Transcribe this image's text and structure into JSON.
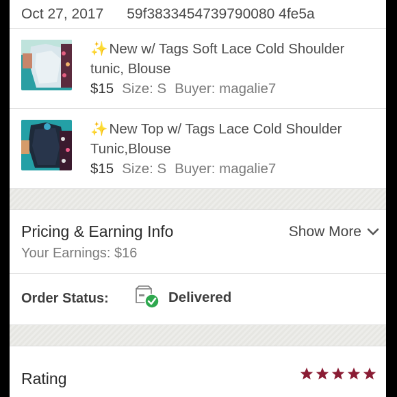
{
  "order": {
    "date": "Oct 27, 2017",
    "id": "59f3833454739790080 4fe5a"
  },
  "items": [
    {
      "sparkle": "✨",
      "title": "New w/ Tags Soft Lace Cold Shoulder tunic, Blouse",
      "price": "$15",
      "size": "Size: S",
      "buyer": "Buyer: magalie7"
    },
    {
      "sparkle": "✨",
      "title": "New Top w/ Tags Lace Cold Shoulder Tunic,Blouse",
      "price": "$15",
      "size": "Size: S",
      "buyer": "Buyer: magalie7"
    }
  ],
  "pricing": {
    "title": "Pricing & Earning Info",
    "earnings": "Your Earnings: $16",
    "show_more": "Show More",
    "chevron_icon": "chevron-down-icon"
  },
  "status": {
    "label": "Order Status:",
    "value": "Delivered",
    "icon": "delivered-box-check-icon",
    "check_color": "#2fa84f"
  },
  "rating": {
    "label": "Rating",
    "stars": 5,
    "max_stars": 5,
    "star_color": "#8a1c34"
  }
}
